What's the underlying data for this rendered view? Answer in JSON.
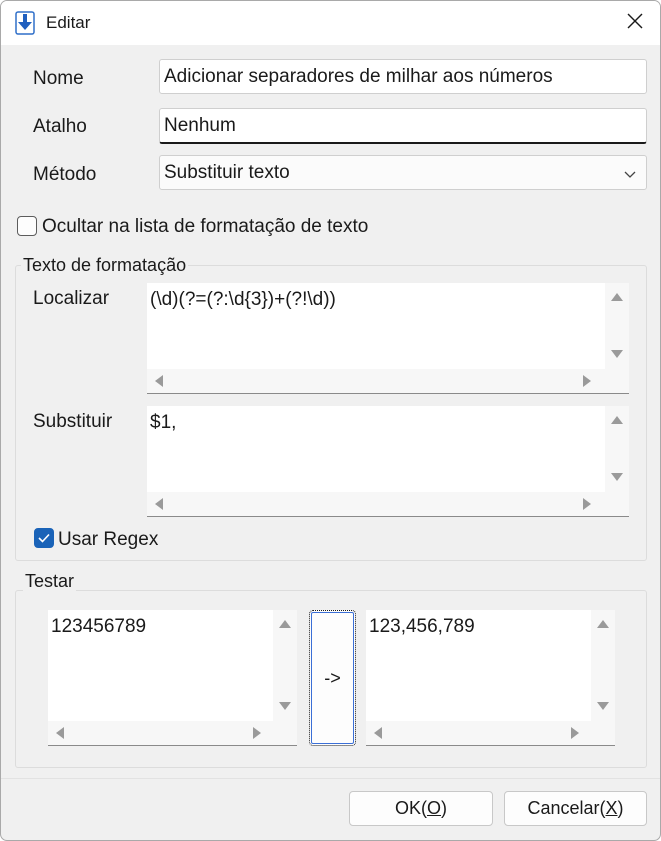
{
  "window": {
    "title": "Editar"
  },
  "form": {
    "name_label": "Nome",
    "name_value": "Adicionar separadores de milhar aos números",
    "shortcut_label": "Atalho",
    "shortcut_value": "Nenhum",
    "method_label": "Método",
    "method_value": "Substituir texto"
  },
  "hide_checkbox": {
    "label": "Ocultar na lista de formatação de texto",
    "checked": false
  },
  "format_group": {
    "title": "Texto de formatação",
    "find_label": "Localizar",
    "find_value": "(\\d)(?=(?:\\d{3})+(?!\\d))",
    "replace_label": "Substituir",
    "replace_value": "$1,",
    "regex_label": "Usar Regex",
    "regex_checked": true
  },
  "test_group": {
    "title": "Testar",
    "input_value": "123456789",
    "run_label": "->",
    "output_value": "123,456,789"
  },
  "footer": {
    "ok_text": "OK(",
    "ok_key": "O",
    "cancel_text": "Cancelar(",
    "cancel_key": "X",
    "close_paren": ")"
  },
  "colors": {
    "accent": "#1a63b8",
    "dialog_bg": "#f0f0f0"
  }
}
